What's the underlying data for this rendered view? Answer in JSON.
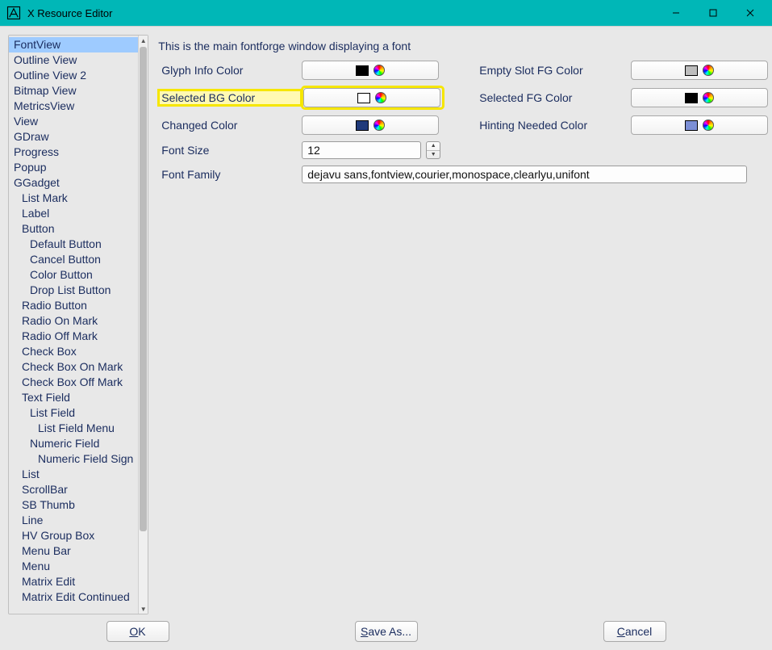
{
  "window": {
    "title": "X Resource Editor"
  },
  "tree": {
    "items": [
      {
        "label": "FontView",
        "selected": true,
        "indent": 0
      },
      {
        "label": "Outline View",
        "indent": 0
      },
      {
        "label": "Outline View 2",
        "indent": 0
      },
      {
        "label": "Bitmap View",
        "indent": 0
      },
      {
        "label": "MetricsView",
        "indent": 0
      },
      {
        "label": "View",
        "indent": 0
      },
      {
        "label": "GDraw",
        "indent": 0
      },
      {
        "label": "Progress",
        "indent": 0
      },
      {
        "label": "Popup",
        "indent": 0
      },
      {
        "label": "GGadget",
        "indent": 0
      },
      {
        "label": "List Mark",
        "indent": 1
      },
      {
        "label": "Label",
        "indent": 1
      },
      {
        "label": "Button",
        "indent": 1
      },
      {
        "label": "Default Button",
        "indent": 2
      },
      {
        "label": "Cancel Button",
        "indent": 2
      },
      {
        "label": "Color Button",
        "indent": 2
      },
      {
        "label": "Drop List Button",
        "indent": 2
      },
      {
        "label": "Radio Button",
        "indent": 1
      },
      {
        "label": "Radio On Mark",
        "indent": 1
      },
      {
        "label": "Radio Off Mark",
        "indent": 1
      },
      {
        "label": "Check Box",
        "indent": 1
      },
      {
        "label": "Check Box On Mark",
        "indent": 1
      },
      {
        "label": "Check Box Off Mark",
        "indent": 1
      },
      {
        "label": "Text Field",
        "indent": 1
      },
      {
        "label": "List Field",
        "indent": 2
      },
      {
        "label": "List Field Menu",
        "indent": 3
      },
      {
        "label": "Numeric Field",
        "indent": 2
      },
      {
        "label": "Numeric Field Sign",
        "indent": 3
      },
      {
        "label": "List",
        "indent": 1
      },
      {
        "label": "ScrollBar",
        "indent": 1
      },
      {
        "label": "SB Thumb",
        "indent": 1
      },
      {
        "label": "Line",
        "indent": 1
      },
      {
        "label": "HV Group Box",
        "indent": 1
      },
      {
        "label": "Menu Bar",
        "indent": 1
      },
      {
        "label": "Menu",
        "indent": 1
      },
      {
        "label": "Matrix Edit",
        "indent": 1
      },
      {
        "label": "Matrix Edit Continued",
        "indent": 1
      }
    ]
  },
  "content": {
    "description": "This is the main fontforge window displaying a font",
    "rows": {
      "glyph_info_color": {
        "label": "Glyph Info Color",
        "swatch": "#000000"
      },
      "empty_slot_fg_color": {
        "label": "Empty Slot FG Color",
        "swatch": "#bdbdbd"
      },
      "selected_bg_color": {
        "label": "Selected BG Color",
        "swatch": "#ffffff",
        "highlighted": true
      },
      "selected_fg_color": {
        "label": "Selected FG Color",
        "swatch": "#000000"
      },
      "changed_color": {
        "label": "Changed Color",
        "swatch": "#203a7a"
      },
      "hinting_needed_color": {
        "label": "Hinting Needed Color",
        "swatch": "#7c8fd6"
      },
      "font_size": {
        "label": "Font Size",
        "value": "12"
      },
      "font_family": {
        "label": "Font Family",
        "value": "dejavu sans,fontview,courier,monospace,clearlyu,unifont"
      }
    }
  },
  "footer": {
    "ok": "OK",
    "save_as": "Save As...",
    "cancel": "Cancel"
  }
}
